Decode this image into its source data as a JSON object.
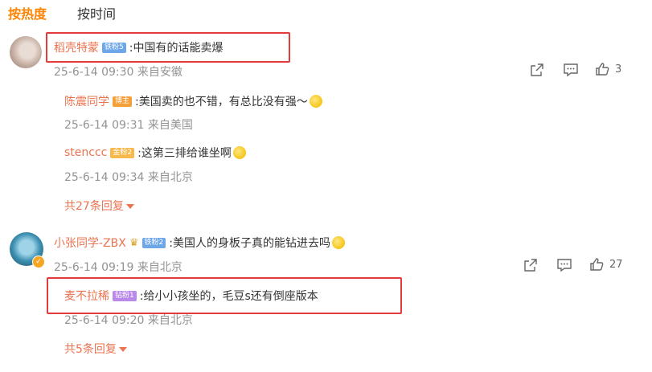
{
  "tabs": {
    "hot": "按热度",
    "time": "按时间"
  },
  "comments": [
    {
      "user": "稻壳特蒙",
      "badge": "铁粉5",
      "text": ":中国有的话能卖爆",
      "date": "25-6-14 09:30",
      "location": "来自安徽",
      "likes": "3",
      "replies": [
        {
          "user": "陈震同学",
          "badge": "博主",
          "text": ":美国卖的也不错，有总比没有强～",
          "date": "25-6-14 09:31",
          "location": "来自美国"
        },
        {
          "user": "stenccc",
          "badge": "金粉2",
          "text": ":这第三排给谁坐啊",
          "date": "25-6-14 09:34",
          "location": "来自北京"
        }
      ],
      "expand": "共27条回复"
    },
    {
      "user": "小张同学-ZBX",
      "badge": "铁粉2",
      "text": ":美国人的身板子真的能钻进去吗",
      "date": "25-6-14 09:19",
      "location": "来自北京",
      "likes": "27",
      "replies": [
        {
          "user": "麦不拉稀",
          "badge": "钻粉1",
          "text": ":给小小孩坐的，毛豆s还有倒座版本",
          "date": "25-6-14 09:20",
          "location": "来自北京"
        }
      ],
      "expand": "共5条回复"
    }
  ],
  "icons": {
    "share": "share-icon",
    "comment": "comment-icon",
    "like": "thumbs-up-icon",
    "emoji": "laughing-tears-emoji",
    "crown": "crown-icon",
    "verified": "verified-badge"
  },
  "colors": {
    "accent": "#ff8200",
    "username": "#eb7350",
    "meta": "#939393",
    "highlight": "#e33b3b"
  }
}
